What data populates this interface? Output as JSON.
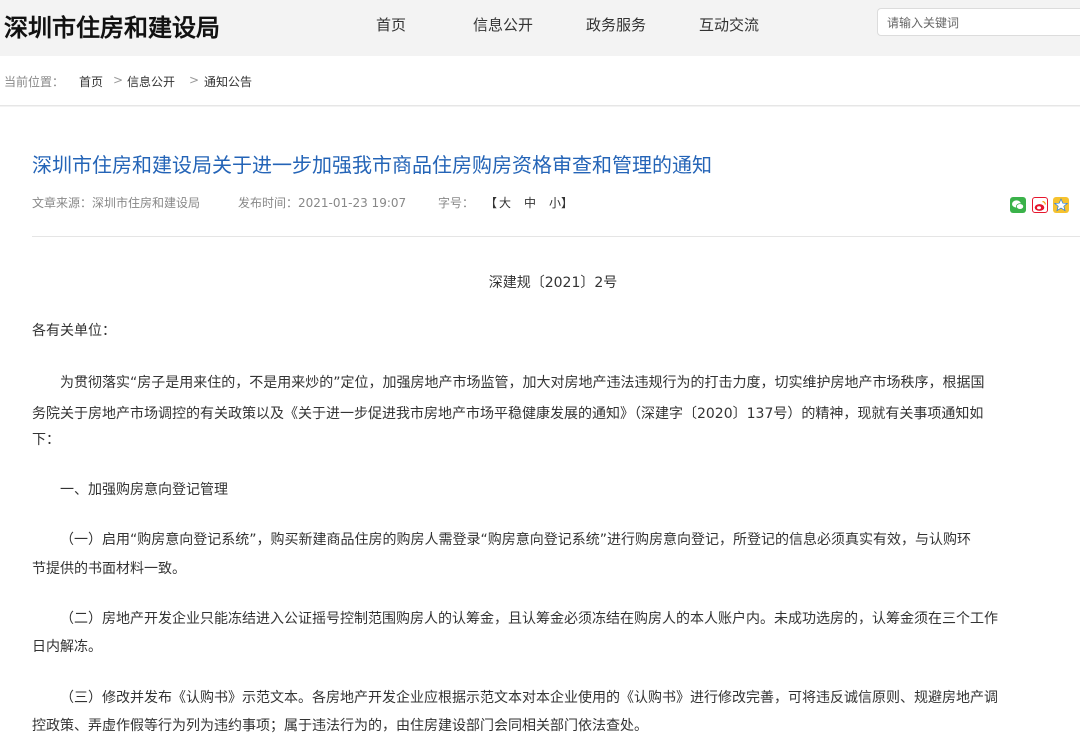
{
  "header": {
    "site_title": "深圳市住房和建设局",
    "nav": [
      "首页",
      "信息公开",
      "政务服务",
      "互动交流"
    ],
    "search_placeholder": "请输入关键词"
  },
  "breadcrumb": {
    "label": "当前位置：",
    "items": [
      "首页",
      "信息公开",
      "通知公告"
    ],
    "separator": ">"
  },
  "article": {
    "title": "深圳市住房和建设局关于进一步加强我市商品住房购房资格审查和管理的通知",
    "source": "文章来源：深圳市住房和建设局",
    "published": "发布时间：2021-01-23 19:07",
    "font_size_label": "字号：",
    "font_size_open": "【",
    "font_sizes": [
      "大",
      "中",
      "小"
    ],
    "font_size_close": "】",
    "share_icons": [
      "wechat-icon",
      "weibo-icon",
      "qzone-icon"
    ],
    "doc_number": "深建规〔2021〕2号",
    "salutation": "各有关单位：",
    "lines": [
      "为贯彻落实“房子是用来住的，不是用来炒的”定位，加强房地产市场监管，加大对房地产违法违规行为的打击力度，切实维护房地产市场秩序，根据国",
      "务院关于房地产市场调控的有关政策以及《关于进一步促进我市房地产市场平稳健康发展的通知》（深建字〔2020〕137号）的精神，现就有关事项通知如",
      "下：",
      "一、加强购房意向登记管理",
      "（一）启用“购房意向登记系统”，购买新建商品住房的购房人需登录“购房意向登记系统”进行购房意向登记，所登记的信息必须真实有效，与认购环",
      "节提供的书面材料一致。",
      "（二）房地产开发企业只能冻结进入公证摇号控制范围购房人的认筹金，且认筹金必须冻结在购房人的本人账户内。未成功选房的，认筹金须在三个工作",
      "日内解冻。",
      "（三）修改并发布《认购书》示范文本。各房地产开发企业应根据示范文本对本企业使用的《认购书》进行修改完善，可将违反诚信原则、规避房地产调",
      "控政策、弄虚作假等行为列为违约事项；属于违法行为的，由住房建设部门会同相关部门依法查处。"
    ]
  },
  "colors": {
    "title_blue": "#2464b7",
    "wechat_green": "#3ab24a",
    "weibo_red": "#e6162d",
    "qzone_yellow": "#f6c22e"
  }
}
